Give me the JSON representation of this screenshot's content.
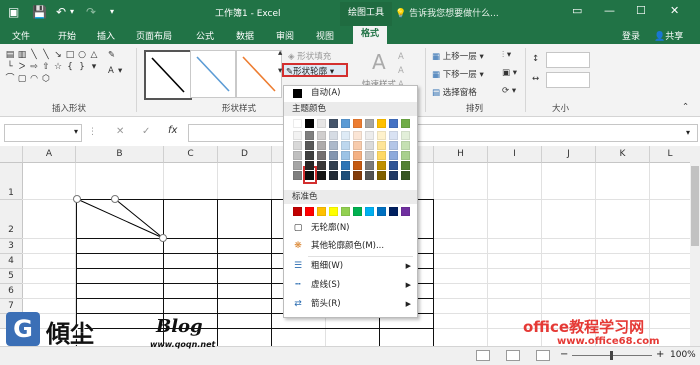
{
  "title_bar": {
    "title": "工作簿1 - Excel",
    "context_tab": "绘图工具",
    "tell_me": "告诉我您想要做什么..."
  },
  "tabs": [
    "文件",
    "开始",
    "插入",
    "页面布局",
    "公式",
    "数据",
    "审阅",
    "视图",
    "格式"
  ],
  "active_tab": "格式",
  "account": {
    "login": "登录",
    "share": "共享"
  },
  "ribbon": {
    "insert_shapes_label": "插入形状",
    "shape_styles_label": "形状样式",
    "shape_fill": "形状填充",
    "shape_outline": "形状轮廓",
    "quick_styles": "快速样式",
    "arrange_label": "排列",
    "bring_forward": "上移一层",
    "send_backward": "下移一层",
    "selection_pane": "选择窗格",
    "size_label": "大小"
  },
  "formula_bar": {
    "fx": "fx",
    "cancel": "✕",
    "enter": "✓"
  },
  "columns": [
    "A",
    "B",
    "C",
    "D",
    "E",
    "F",
    "G",
    "H",
    "I",
    "J",
    "K",
    "L"
  ],
  "rows": [
    "1",
    "2",
    "3",
    "4",
    "5",
    "6",
    "7",
    "8"
  ],
  "outline_menu": {
    "automatic": "自动(A)",
    "theme_colors": "主题颜色",
    "standard_colors": "标准色",
    "no_outline": "无轮廓(N)",
    "more_colors": "其他轮廓颜色(M)...",
    "weight": "粗细(W)",
    "dashes": "虚线(S)",
    "arrows": "箭头(R)"
  },
  "theme_colors": [
    [
      "#ffffff",
      "#000000",
      "#e7e6e6",
      "#44546a",
      "#5b9bd5",
      "#ed7d31",
      "#a5a5a5",
      "#ffc000",
      "#4472c4",
      "#70ad47"
    ],
    [
      "#f2f2f2",
      "#7f7f7f",
      "#d0cece",
      "#d6dce4",
      "#deebf6",
      "#fbe5d5",
      "#ededed",
      "#fff2cc",
      "#d9e2f3",
      "#e2efd9"
    ],
    [
      "#d8d8d8",
      "#595959",
      "#aeabab",
      "#adb9ca",
      "#bdd7ee",
      "#f7cbac",
      "#dbdbdb",
      "#fee599",
      "#b4c6e7",
      "#c5e0b3"
    ],
    [
      "#bfbfbf",
      "#3f3f3f",
      "#757070",
      "#8496b0",
      "#9cc3e5",
      "#f4b183",
      "#c9c9c9",
      "#ffd965",
      "#8eaadb",
      "#a8d08d"
    ],
    [
      "#a5a5a5",
      "#262626",
      "#3a3838",
      "#323f4f",
      "#2e75b5",
      "#c55a11",
      "#7b7b7b",
      "#bf9000",
      "#2f5496",
      "#538135"
    ],
    [
      "#7f7f7f",
      "#0c0c0c",
      "#171616",
      "#222a35",
      "#1e4e79",
      "#833c0b",
      "#525252",
      "#7f6000",
      "#1f3864",
      "#375623"
    ]
  ],
  "standard_colors": [
    "#c00000",
    "#ff0000",
    "#ffc000",
    "#ffff00",
    "#92d050",
    "#00b050",
    "#00b0f0",
    "#0070c0",
    "#002060",
    "#7030a0"
  ],
  "status": {
    "zoom": "100%",
    "zoom_minus": "−",
    "zoom_plus": "+"
  },
  "watermark_left": {
    "glyph": "G",
    "brand": "傾尘",
    "italic": "Blog",
    "url": "www.qoqn.net"
  },
  "watermark_right": {
    "title": "office教程学习网",
    "url": "www.office68.com"
  }
}
